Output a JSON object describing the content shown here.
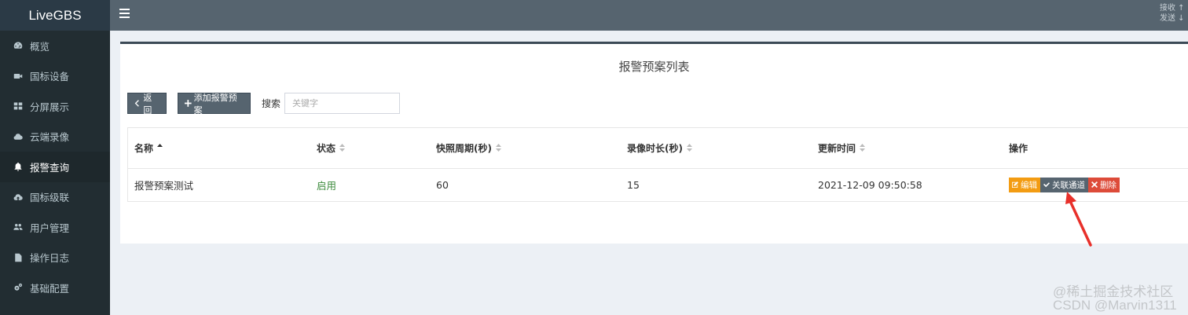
{
  "app": {
    "brand": "LiveGBS"
  },
  "sidebar": {
    "items": [
      {
        "label": "概览",
        "icon": "dashboard-icon"
      },
      {
        "label": "国标设备",
        "icon": "video-camera-icon"
      },
      {
        "label": "分屏展示",
        "icon": "grid-icon"
      },
      {
        "label": "云端录像",
        "icon": "cloud-icon"
      },
      {
        "label": "报警查询",
        "icon": "bell-icon",
        "active": true
      },
      {
        "label": "国标级联",
        "icon": "cloud-upload-icon"
      },
      {
        "label": "用户管理",
        "icon": "users-icon"
      },
      {
        "label": "操作日志",
        "icon": "file-icon"
      },
      {
        "label": "基础配置",
        "icon": "cogs-icon"
      }
    ]
  },
  "header": {
    "recv": "接收 ↑",
    "send": "发送 ↓"
  },
  "page": {
    "title": "报警预案列表",
    "back_label": "返回",
    "add_label": "添加报警预案",
    "search_label": "搜索",
    "search_placeholder": "关键字"
  },
  "table": {
    "columns": [
      "名称",
      "状态",
      "快照周期(秒)",
      "录像时长(秒)",
      "更新时间",
      "操作"
    ],
    "rows": [
      {
        "name": "报警预案测试",
        "status": "启用",
        "snapshot": "60",
        "record": "15",
        "updated": "2021-12-09 09:50:58"
      }
    ],
    "actions": {
      "edit": "编辑",
      "link": "关联通道",
      "delete": "删除"
    }
  },
  "watermark": "@稀土掘金技术社区\nCSDN @Marvin1311",
  "colors": {
    "sidebar": "#222d32",
    "header": "#56646f",
    "edit": "#f39c12",
    "delete": "#dd4b39",
    "arrow": "#e8302a"
  }
}
